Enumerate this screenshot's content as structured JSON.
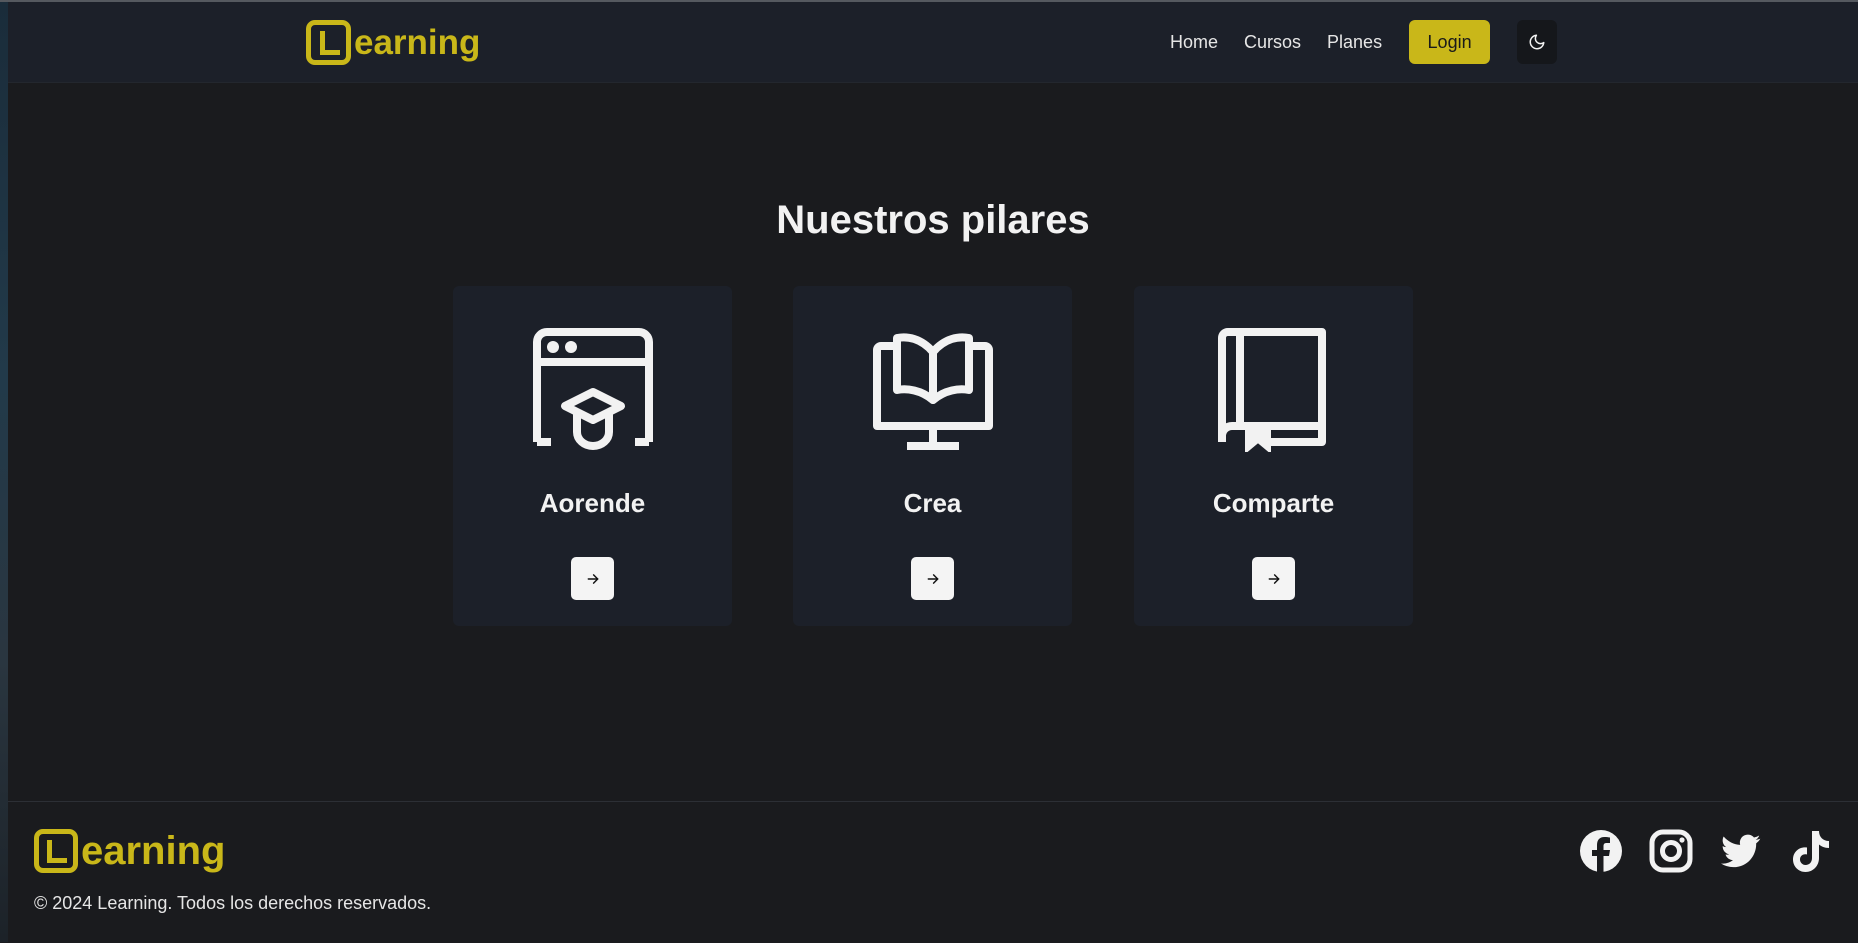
{
  "header": {
    "logo_text": "earning",
    "logo_letter": "L",
    "nav": [
      {
        "label": "Home"
      },
      {
        "label": "Cursos"
      },
      {
        "label": "Planes"
      }
    ],
    "login_label": "Login",
    "theme_icon": "moon-icon"
  },
  "main": {
    "title": "Nuestros pilares",
    "cards": [
      {
        "title": "Aorende",
        "icon": "browser-graduation-cap-icon",
        "action_icon": "arrow-right-icon"
      },
      {
        "title": "Crea",
        "icon": "monitor-book-icon",
        "action_icon": "arrow-right-icon"
      },
      {
        "title": "Comparte",
        "icon": "bookmark-book-icon",
        "action_icon": "arrow-right-icon"
      }
    ]
  },
  "footer": {
    "logo_text": "earning",
    "copyright": "© 2024 Learning. Todos los derechos reservados.",
    "social": [
      "facebook-icon",
      "instagram-icon",
      "twitter-icon",
      "tiktok-icon"
    ]
  },
  "colors": {
    "accent": "#c9b719",
    "background": "#1a1b1e",
    "header_bg": "#1c2029",
    "card_bg": "#1c2029",
    "text": "#f2f2f2"
  }
}
